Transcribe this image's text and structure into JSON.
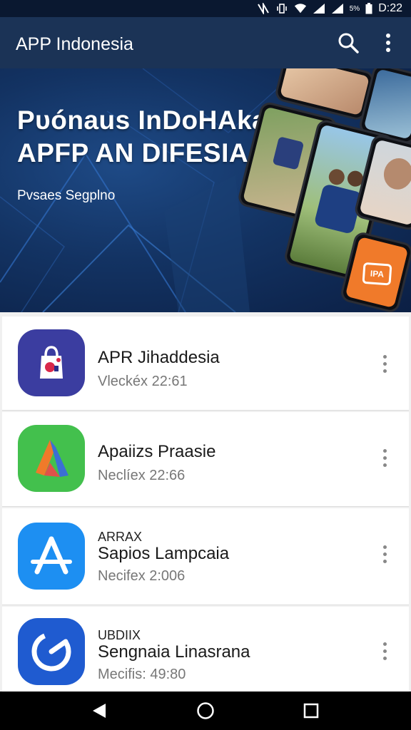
{
  "status_bar": {
    "time": "D:22",
    "battery_text": "5%",
    "icons": [
      "nfc-icon",
      "vibrate-icon",
      "wifi-icon",
      "signal-icon",
      "signal-icon",
      "battery-icon"
    ]
  },
  "app_bar": {
    "title": "APP Indonesia",
    "icons": [
      "search-icon",
      "more-vert-icon"
    ]
  },
  "banner": {
    "title_line1": "Pυónaus InDoHAka",
    "title_line2": "APFP AN DIFESIA",
    "subtitle": "Pvsaes Segplno",
    "badge_text": "IPA"
  },
  "apps": [
    {
      "tag": "",
      "name": "APR Jihaddesia",
      "meta": "Vleckéx 22:61",
      "icon": "shopping-bag-icon",
      "color": "#3b3da0"
    },
    {
      "tag": "",
      "name": "Apaiizs Praasie",
      "meta": "Neclíex 22:66",
      "icon": "triangle-logo-icon",
      "color": "#43c04d"
    },
    {
      "tag": "ARRAX",
      "name": "Sapios Lampcaia",
      "meta": "Necifex 2:006",
      "icon": "app-store-icon",
      "color": "#1d8ff2"
    },
    {
      "tag": "UBDIIX",
      "name": "Sengnaia Linasrana",
      "meta": "Mecifis: 49:80",
      "icon": "refresh-g-icon",
      "color": "#1f5bd0"
    }
  ],
  "nav_bar": {
    "buttons": [
      "back-icon",
      "home-icon",
      "recents-icon"
    ]
  },
  "colors": {
    "status_bar": "#0a1830",
    "app_bar": "#1b3356",
    "banner_bg": "#133363",
    "list_bg": "#f0f0f0"
  }
}
